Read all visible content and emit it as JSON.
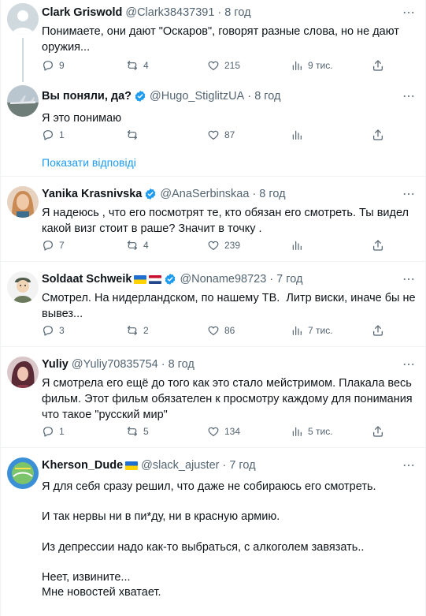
{
  "tweets": [
    {
      "name": "Clark Griswold",
      "handle": "@Clark38437391",
      "time": "8 год",
      "text": "Понимаете, они дают \"Оскаров\", говорят разные слова, но не дают оружия...",
      "reply": "9",
      "retweet": "4",
      "like": "215",
      "views": "9 тис."
    },
    {
      "name": "Вы поняли, да?",
      "handle": "@Hugo_StiglitzUA",
      "time": "8 год",
      "text": "Я это понимаю",
      "reply": "1",
      "retweet": "",
      "like": "87",
      "views": ""
    },
    {
      "name": "Yanika Krasnivska",
      "handle": "@AnaSerbinskaa",
      "time": "8 год",
      "text": "Я надеюсь , что его посмотрят те, кто обязан его смотреть. Ты видел какой визг стоит в раше? Значит в точку .",
      "reply": "7",
      "retweet": "4",
      "like": "239",
      "views": ""
    },
    {
      "name": "Soldaat Schweik",
      "handle": "@Noname98723",
      "time": "7 год",
      "text": "Смотрел. На нидерландском, по нашему ТВ.  Литр виски, иначе бы не вывез...",
      "reply": "3",
      "retweet": "2",
      "like": "86",
      "views": "7 тис."
    },
    {
      "name": "Yuliy",
      "handle": "@Yuliy70835754",
      "time": "8 год",
      "text": "Я смотрела его ещё до того как это стало мейстримом. Плакала весь фильм. Этот фильм обязателен к просмотру каждому для понимания что такое \"русский мир\"",
      "reply": "1",
      "retweet": "5",
      "like": "134",
      "views": "5 тис."
    },
    {
      "name": "Kherson_Dude",
      "handle": "@slack_ajuster",
      "time": "7 год",
      "text": "Я для себя сразу решил, что даже не собираюсь его смотреть.\n\nИ так нервы ни в пи*ду, ни в красную армию.\n\nИз депрессии надо как-то выбраться, с алкоголем завязать..\n\nНеет, извините...\nМне новостей хватает.\n\nЯ свою жизнь нормально не могу жить, пока моя страна истекает ..."
    }
  ],
  "show_replies": "Показати відповіді",
  "colors": {
    "link": "#1d9bf0",
    "verified": "#1d9bf0",
    "muted": "#536471"
  }
}
